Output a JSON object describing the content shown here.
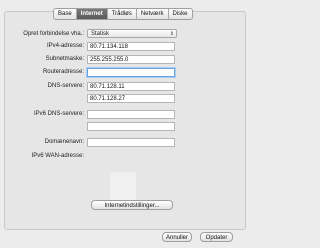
{
  "tabs": [
    "Base",
    "Internet",
    "Trådløs",
    "Netværk",
    "Diske"
  ],
  "active_tab": "Internet",
  "form": {
    "connection_label": "Opret forbindelse vha.:",
    "connection_value": "Statisk",
    "ipv4_label": "IPv4-adresse:",
    "ipv4_value": "80.71.134.118",
    "subnet_label": "Subnetmaske:",
    "subnet_value": "255.255.255.0",
    "router_label": "Routeradresse:",
    "router_value": "",
    "dns_label": "DNS-servere:",
    "dns1_value": "80.71.128.11",
    "dns2_value": "80.71.128.27",
    "ipv6dns_label": "IPv6 DNS-servere:",
    "ipv6dns1_value": "",
    "ipv6dns2_value": "",
    "domain_label": "Domænenavn:",
    "domain_value": "",
    "ipv6wan_label": "IPv6 WAN-adresse:"
  },
  "buttons": {
    "advanced": "Internetindstillinger...",
    "cancel": "Annuller",
    "ok": "Opdater"
  }
}
